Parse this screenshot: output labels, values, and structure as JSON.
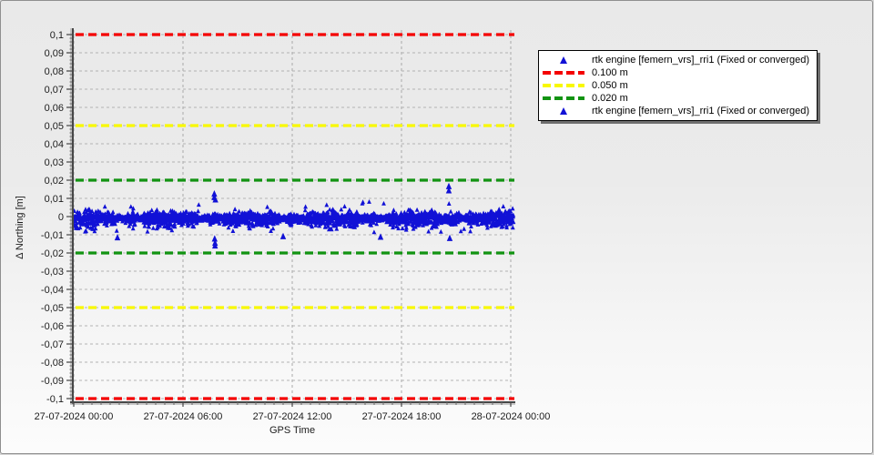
{
  "window": {
    "border_color": "#8f8f8f",
    "background_top": "#e9e9e9",
    "background_bottom": "#fcfcfc"
  },
  "chart_data": {
    "type": "scatter",
    "title": "",
    "xlabel": "GPS Time",
    "ylabel": "Δ Northing [m]",
    "x_tick_labels": [
      "27-07-2024 00:00",
      "27-07-2024 06:00",
      "27-07-2024 12:00",
      "27-07-2024 18:00",
      "28-07-2024 00:00"
    ],
    "x_range_hours": 24,
    "ylim": [
      -0.1,
      0.1
    ],
    "y_tick_step": 0.01,
    "decimal_separator": ",",
    "y_tick_labels": [
      "0,1",
      "0,09",
      "0,08",
      "0,07",
      "0,06",
      "0,05",
      "0,04",
      "0,03",
      "0,02",
      "0,01",
      "0",
      "-0,01",
      "-0,02",
      "-0,03",
      "-0,04",
      "-0,05",
      "-0,06",
      "-0,07",
      "-0,08",
      "-0,09",
      "-0,1"
    ],
    "grid": true,
    "reference_lines": [
      {
        "label": "0.100 m",
        "value": 0.1,
        "color": "#f40000"
      },
      {
        "label": "0.100 m",
        "value": -0.1,
        "color": "#f40000"
      },
      {
        "label": "0.050 m",
        "value": 0.05,
        "color": "#f8f800"
      },
      {
        "label": "0.050 m",
        "value": -0.05,
        "color": "#f8f800"
      },
      {
        "label": "0.020 m",
        "value": 0.02,
        "color": "#129312"
      },
      {
        "label": "0.020 m",
        "value": -0.02,
        "color": "#129312"
      }
    ],
    "series": [
      {
        "name": "rtk engine [femern_vrs]_rri1 (Fixed or converged)",
        "marker": "triangle",
        "color": "#1111d6",
        "noise_band": {
          "points": 2600,
          "seed": 123456789,
          "center": -0.001,
          "typical_spread": 0.0055,
          "min": -0.0112,
          "max": 0.0082,
          "hours_end": 24.15
        },
        "outliers": [
          {
            "hour": 7.72,
            "value": 0.0122
          },
          {
            "hour": 7.72,
            "value": 0.0103
          },
          {
            "hour": 7.78,
            "value": 0.009
          },
          {
            "hour": 7.76,
            "value": -0.0148
          },
          {
            "hour": 7.76,
            "value": -0.0163
          },
          {
            "hour": 7.74,
            "value": -0.0125
          },
          {
            "hour": 20.6,
            "value": 0.0163
          },
          {
            "hour": 20.6,
            "value": 0.014
          },
          {
            "hour": 2.4,
            "value": -0.0118
          },
          {
            "hour": 11.5,
            "value": -0.0112
          },
          {
            "hour": 16.85,
            "value": -0.0115
          },
          {
            "hour": 20.65,
            "value": -0.0122
          }
        ]
      }
    ],
    "legend": {
      "position": "top-right",
      "entries": [
        {
          "type": "triangle",
          "color": "#1111d6",
          "label": "rtk engine [femern_vrs]_rri1 (Fixed or converged)"
        },
        {
          "type": "dashed-line",
          "color": "#f40000",
          "label": "0.100 m"
        },
        {
          "type": "dashed-line",
          "color": "#f8f800",
          "label": "0.050 m"
        },
        {
          "type": "dashed-line",
          "color": "#129312",
          "label": "0.020 m"
        },
        {
          "type": "triangle",
          "color": "#1111d6",
          "label": "rtk engine [femern_vrs]_rri1 (Fixed or converged)"
        }
      ]
    }
  }
}
